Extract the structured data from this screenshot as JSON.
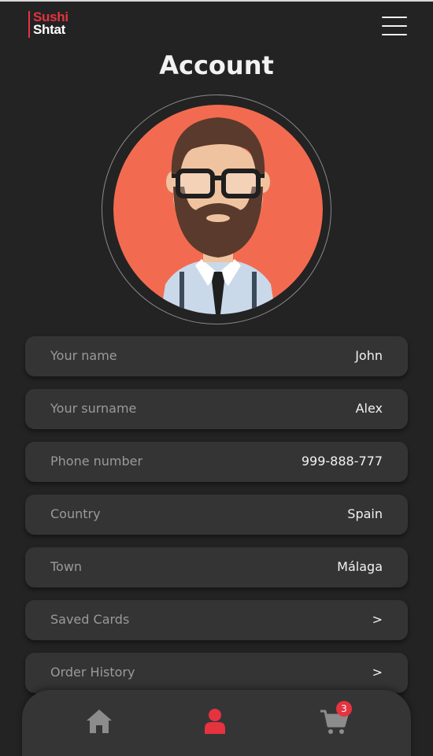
{
  "header": {
    "logo_line1": "Sushi",
    "logo_line2": "Shtat",
    "menu_icon": "hamburger-menu-icon"
  },
  "page": {
    "title": "Account"
  },
  "avatar": {
    "icon": "user-avatar-bearded-man"
  },
  "fields": [
    {
      "label": "Your name",
      "value": "John"
    },
    {
      "label": "Your surname",
      "value": "Alex"
    },
    {
      "label": "Phone number",
      "value": "999-888-777"
    },
    {
      "label": "Country",
      "value": "Spain"
    },
    {
      "label": "Town",
      "value": "Málaga"
    },
    {
      "label": "Saved Cards",
      "value": ">"
    },
    {
      "label": "Order History",
      "value": ">"
    }
  ],
  "bottom_nav": {
    "home_icon": "home-icon",
    "account_icon": "user-icon",
    "cart_icon": "cart-icon",
    "cart_count": "3",
    "active_color": "#e53340",
    "inactive_color": "#8c8c8c"
  },
  "colors": {
    "background": "#232323",
    "card": "#343434",
    "accent": "#e53340",
    "avatar_bg": "#f26b50"
  }
}
